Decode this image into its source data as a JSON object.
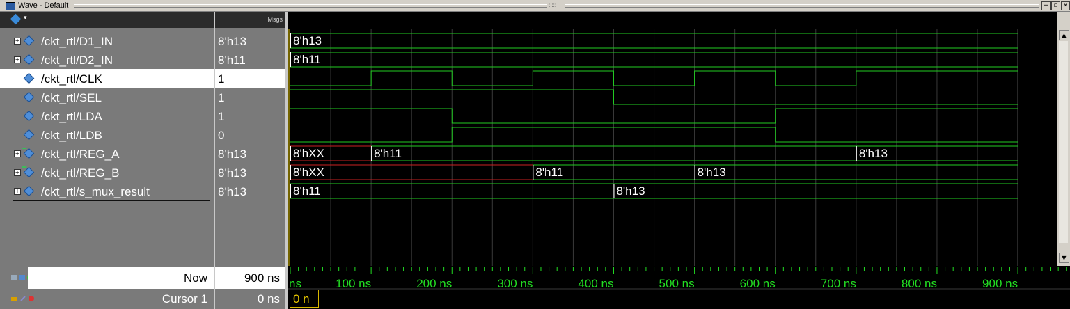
{
  "window": {
    "title": "Wave - Default"
  },
  "header": {
    "msgs_label": "Msgs"
  },
  "signals": [
    {
      "name": "/ckt_rtl/D1_IN",
      "value": "8'h13",
      "expandable": true,
      "selected": false
    },
    {
      "name": "/ckt_rtl/D2_IN",
      "value": "8'h11",
      "expandable": true,
      "selected": false
    },
    {
      "name": "/ckt_rtl/CLK",
      "value": "1",
      "expandable": false,
      "selected": true
    },
    {
      "name": "/ckt_rtl/SEL",
      "value": "1",
      "expandable": false,
      "selected": false
    },
    {
      "name": "/ckt_rtl/LDA",
      "value": "1",
      "expandable": false,
      "selected": false
    },
    {
      "name": "/ckt_rtl/LDB",
      "value": "0",
      "expandable": false,
      "selected": false
    },
    {
      "name": "/ckt_rtl/REG_A",
      "value": "8'h13",
      "expandable": true,
      "selected": false
    },
    {
      "name": "/ckt_rtl/REG_B",
      "value": "8'h13",
      "expandable": true,
      "selected": false
    },
    {
      "name": "/ckt_rtl/s_mux_result",
      "value": "8'h13",
      "expandable": true,
      "selected": false
    }
  ],
  "waves": {
    "time_range_ns": [
      0,
      900
    ],
    "bus": [
      {
        "segments": [
          {
            "t0": 0,
            "t1": 900,
            "label": "8'h13",
            "unknown": false
          }
        ]
      },
      {
        "segments": [
          {
            "t0": 0,
            "t1": 900,
            "label": "8'h11",
            "unknown": false
          }
        ]
      },
      null,
      null,
      null,
      null,
      {
        "segments": [
          {
            "t0": 0,
            "t1": 100,
            "label": "8'hXX",
            "unknown": true
          },
          {
            "t0": 100,
            "t1": 700,
            "label": "8'h11",
            "unknown": false
          },
          {
            "t0": 700,
            "t1": 900,
            "label": "8'h13",
            "unknown": false
          }
        ]
      },
      {
        "segments": [
          {
            "t0": 0,
            "t1": 300,
            "label": "8'hXX",
            "unknown": true
          },
          {
            "t0": 300,
            "t1": 500,
            "label": "8'h11",
            "unknown": false
          },
          {
            "t0": 500,
            "t1": 900,
            "label": "8'h13",
            "unknown": false
          }
        ]
      },
      {
        "segments": [
          {
            "t0": 0,
            "t1": 400,
            "label": "8'h11",
            "unknown": false
          },
          {
            "t0": 400,
            "t1": 900,
            "label": "8'h13",
            "unknown": false
          }
        ]
      }
    ],
    "bits": [
      null,
      null,
      {
        "changes": [
          [
            0,
            0
          ],
          [
            100,
            1
          ],
          [
            200,
            0
          ],
          [
            300,
            1
          ],
          [
            400,
            0
          ],
          [
            500,
            1
          ],
          [
            600,
            0
          ],
          [
            700,
            1
          ]
        ]
      },
      {
        "changes": [
          [
            0,
            1
          ],
          [
            400,
            0
          ]
        ]
      },
      {
        "changes": [
          [
            0,
            1
          ],
          [
            200,
            0
          ],
          [
            600,
            1
          ]
        ]
      },
      {
        "changes": [
          [
            0,
            0
          ],
          [
            200,
            1
          ],
          [
            600,
            0
          ]
        ]
      },
      null,
      null,
      null
    ]
  },
  "timeline": {
    "ticks": [
      "ns",
      "100 ns",
      "200 ns",
      "300 ns",
      "400 ns",
      "500 ns",
      "600 ns",
      "700 ns",
      "800 ns",
      "900 ns"
    ]
  },
  "status": {
    "now_label": "Now",
    "now_value": "900 ns",
    "cursor_label": "Cursor 1",
    "cursor_value": "0 ns",
    "cursor_tag": "0 n"
  },
  "colors": {
    "wave": "#22cc22",
    "unknown": "#cc2222",
    "gridline": "#3a3a3a",
    "cursor": "#e8c800"
  }
}
